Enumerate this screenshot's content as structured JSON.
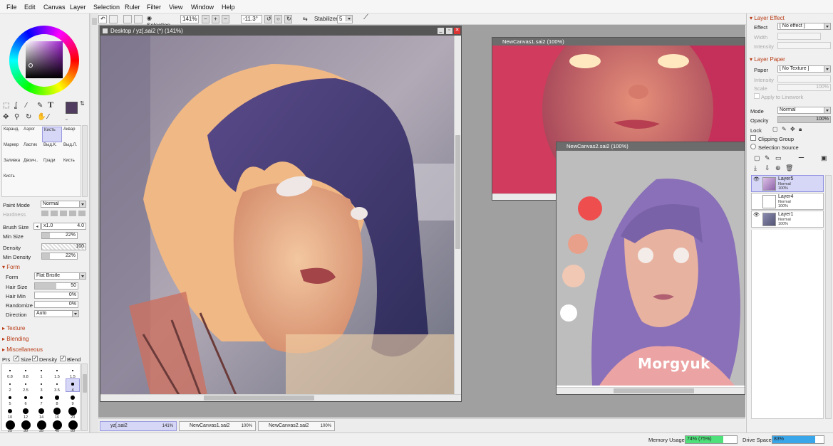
{
  "menu": [
    "File",
    "Edit",
    "Canvas",
    "Layer",
    "Selection",
    "Ruler",
    "Filter",
    "View",
    "Window",
    "Help"
  ],
  "toolbar": {
    "selection_label": "Selection",
    "zoom": "141%",
    "rotation": "-11.3°",
    "stabilizer_label": "Stabilizer",
    "stabilizer_value": "5"
  },
  "windows": {
    "main_title": "Desktop / yz[.sai2 (*) (141%)",
    "canvas1_title": "NewCanvas1.sai2 (100%)",
    "canvas2_title": "NewCanvas2.sai2 (100%)",
    "canvas2_signature": "Morgyuk"
  },
  "tools": {
    "cells": [
      "Каранд.",
      "Аэрог",
      "Кисть",
      "Аквар",
      "Маркер",
      "Ластик",
      "Выд.К.",
      "Выд.Л.",
      "Заливка",
      "Двоич..",
      "Гради",
      "Кисть",
      "Кисть"
    ],
    "selected_index": 2
  },
  "brush": {
    "paint_mode_label": "Paint Mode",
    "paint_mode_value": "Normal",
    "hardness_label": "Hardness",
    "brush_size_label": "Brush Size",
    "brush_size_mult": "x1.0",
    "brush_size_value": "4.0",
    "min_size_label": "Min Size",
    "min_size_value": "22%",
    "min_size_fraction": 0.22,
    "density_label": "Density",
    "density_value": "100",
    "min_density_label": "Min Density",
    "min_density_value": "22%",
    "min_density_fraction": 0.22
  },
  "form": {
    "header": "Form",
    "form_label": "Form",
    "form_value": "Flat Bristle",
    "hair_size_label": "Hair Size",
    "hair_size_value": "50",
    "hair_size_fraction": 0.5,
    "hair_min_label": "Hair Min",
    "hair_min_value": "0%",
    "randomize_label": "Randomize",
    "randomize_value": "0%",
    "direction_label": "Direction",
    "direction_value": "Auto"
  },
  "sections": {
    "texture": "Texture",
    "blending": "Blending",
    "misc": "Miscellaneous"
  },
  "presets": {
    "prs_label": "Prs",
    "size": "Size",
    "density": "Density",
    "blend": "Blend",
    "sizes": [
      "0.8",
      "0.8",
      "1",
      "1.5",
      "1.5",
      "2",
      "2.5",
      "3",
      "3.5",
      "4",
      "5",
      "6",
      "7",
      "8",
      "9",
      "10",
      "12",
      "14",
      "16",
      "20",
      "25",
      "30",
      "35",
      "40",
      "50"
    ]
  },
  "right": {
    "layer_effect_header": "Layer Effect",
    "effect_label": "Effect",
    "effect_value": "[ No effect ]",
    "width_label": "Width",
    "intensity_label": "Intensity",
    "layer_paper_header": "Layer Paper",
    "paper_label": "Paper",
    "paper_value": "[ No Texture ]",
    "intensity2_label": "Intensity",
    "scale_label": "Scale",
    "scale_value": "100%",
    "apply_linework": "Apply to Linework",
    "mode_label": "Mode",
    "mode_value": "Normal",
    "opacity_label": "Opacity",
    "opacity_value": "100%",
    "lock_label": "Lock",
    "clipping_group": "Clipping Group",
    "selection_source": "Selection Source"
  },
  "layers": [
    {
      "name": "Layer5",
      "mode": "Normal",
      "opacity": "100%",
      "selected": true,
      "visible": true
    },
    {
      "name": "Layer4",
      "mode": "Normal",
      "opacity": "100%",
      "selected": false,
      "visible": false
    },
    {
      "name": "Layer1",
      "mode": "Normal",
      "opacity": "100%",
      "selected": false,
      "visible": true
    }
  ],
  "taskbar": [
    {
      "name": "yz[.sai2",
      "pct": "141%",
      "selected": true
    },
    {
      "name": "NewCanvas1.sai2",
      "pct": "100%",
      "selected": false
    },
    {
      "name": "NewCanvas2.sai2",
      "pct": "100%",
      "selected": false
    }
  ],
  "status": {
    "memory_label": "Memory Usage",
    "memory_value": "74% (75%)",
    "memory_fraction": 0.74,
    "drive_label": "Drive Space",
    "drive_value": "83%",
    "drive_fraction": 0.83
  },
  "colors": {
    "accent_section": "#b83a14",
    "selected_bg": "#d6d6f7",
    "memory_fill": "#4ee07a",
    "drive_fill": "#3aa6ea",
    "current_color": "#4f3c5e"
  }
}
